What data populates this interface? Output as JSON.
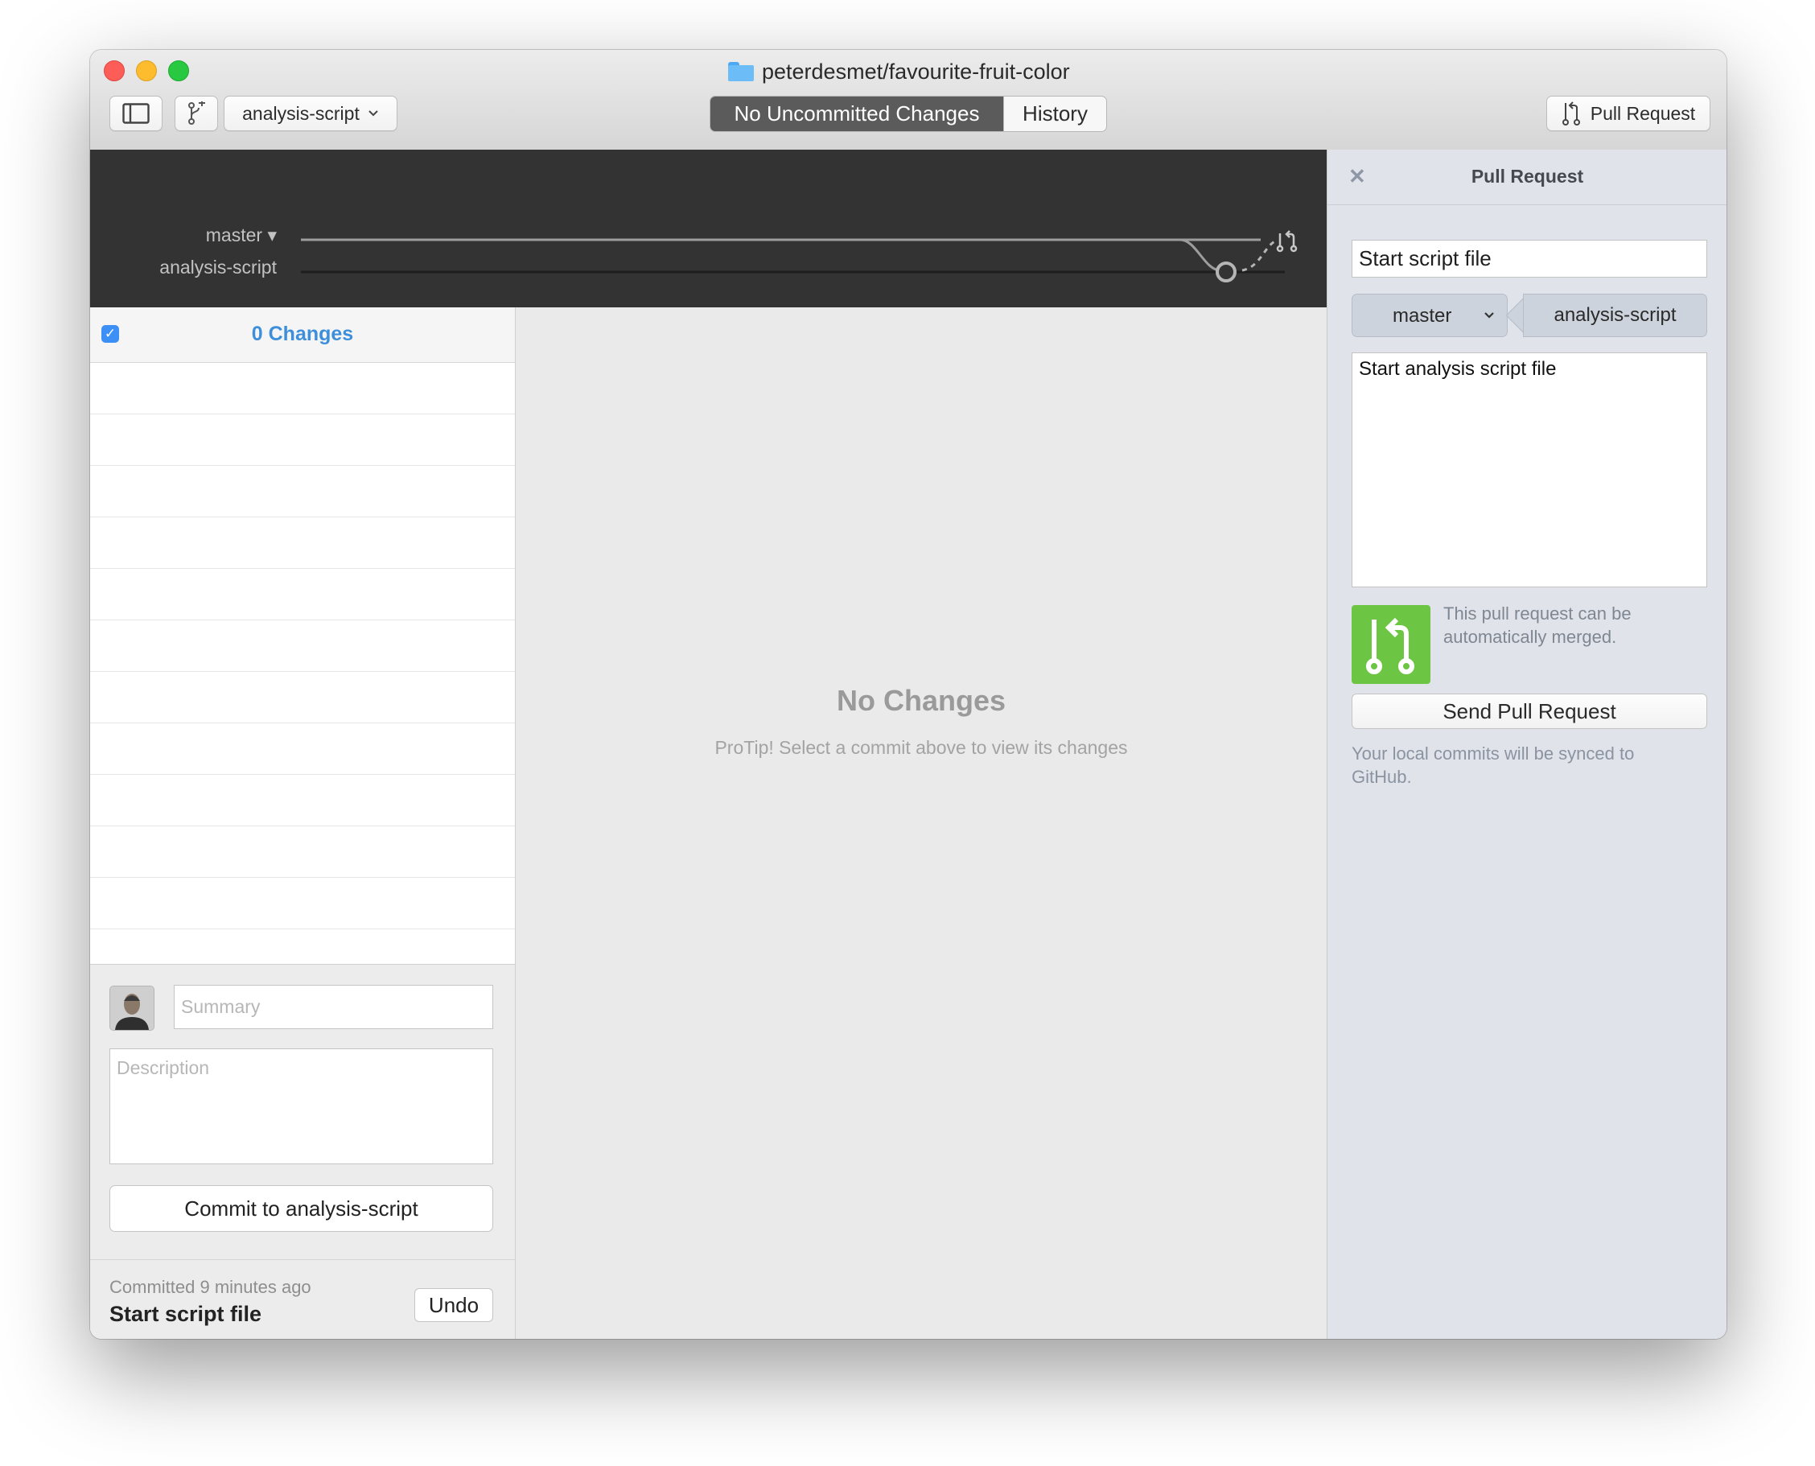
{
  "window": {
    "title": "peterdesmet/favourite-fruit-color"
  },
  "toolbar": {
    "current_branch": "analysis-script",
    "tabs": [
      {
        "label": "No Uncommitted Changes",
        "active": true
      },
      {
        "label": "History",
        "active": false
      }
    ],
    "pull_request_label": "Pull Request"
  },
  "timeline": {
    "branches": [
      "master ▾",
      "analysis-script"
    ]
  },
  "changes": {
    "count_label": "0 Changes",
    "select_all_checked": true
  },
  "commit": {
    "summary_placeholder": "Summary",
    "description_placeholder": "Description",
    "commit_button": "Commit to analysis-script"
  },
  "last_commit": {
    "time": "Committed 9 minutes ago",
    "title": "Start script file",
    "undo_label": "Undo"
  },
  "diff": {
    "empty_title": "No Changes",
    "protip": "ProTip! Select a commit above to view its changes"
  },
  "pull_request_panel": {
    "header": "Pull Request",
    "close_glyph": "✕",
    "title_value": "Start script file",
    "base_branch": "master",
    "compare_branch": "analysis-script",
    "description_value": "Start analysis script file",
    "merge_status": "This pull request can be automatically merged.",
    "send_button": "Send Pull Request",
    "sync_note": "Your local commits will be synced to GitHub."
  },
  "colors": {
    "accent_blue": "#3d8fdb",
    "merge_green": "#6cc644",
    "timeline_bg": "#333333",
    "segment_active": "#5b5b5b",
    "panel_bg": "#e0e4ea"
  },
  "icons": {
    "sidebar_toggle": "sidebar-icon",
    "new_branch": "branch-add-icon",
    "pull_request": "pull-request-icon",
    "folder": "folder-icon",
    "merge": "merge-icon"
  }
}
